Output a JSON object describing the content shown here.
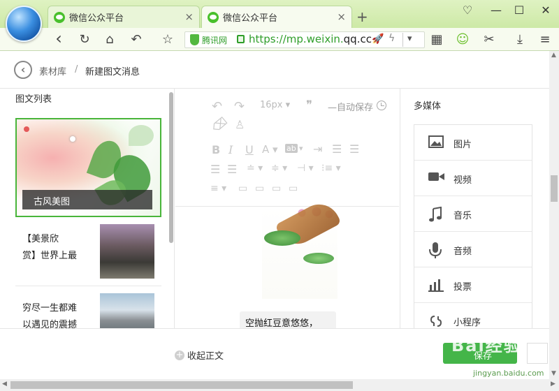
{
  "browser": {
    "tabs": [
      {
        "label": "微信公众平台",
        "close": "×"
      },
      {
        "label": "微信公众平台",
        "close": "×"
      }
    ],
    "new_tab": "+",
    "window_buttons": {
      "skin": "♡",
      "minimize": "—",
      "maximize": "☐",
      "close": "✕"
    },
    "nav": {
      "back": "‹",
      "refresh": "↻",
      "home": "⌂",
      "undo": "↶",
      "favorite": "☆"
    },
    "url": {
      "security_label": "腾讯网",
      "scheme": "https://mp.weixin.",
      "domain": "qq.cc",
      "dropdown": "▾"
    },
    "right_tools": {
      "apps": "▦",
      "ext": "☺",
      "cut": "✂",
      "download": "⤓",
      "menu": "≡"
    }
  },
  "breadcrumb": {
    "back": "‹",
    "home": "素材库",
    "separator": "/",
    "current": "新建图文消息"
  },
  "article_list": {
    "title": "图文列表",
    "items": [
      {
        "caption": "古风美图"
      },
      {
        "lines": [
          "【美景欣",
          "赏】世界上最"
        ]
      },
      {
        "lines": [
          "穷尽一生都难",
          "以遇见的震撼"
        ]
      }
    ]
  },
  "editor": {
    "font_size": "16px",
    "quote": "❞",
    "auto_save": "自动保存",
    "body_text": "空抛红豆意悠悠，",
    "toolbar": {
      "undo": "↶",
      "redo": "↷",
      "bold": "B",
      "italic": "I",
      "underline": "U",
      "font_color": "A",
      "bg_color": "ab",
      "eraser": "⌫",
      "format": "♙"
    }
  },
  "multimedia": {
    "title": "多媒体",
    "items": [
      {
        "label": "图片",
        "icon": "image-icon"
      },
      {
        "label": "视频",
        "icon": "video-icon"
      },
      {
        "label": "音乐",
        "icon": "music-icon"
      },
      {
        "label": "音频",
        "icon": "microphone-icon"
      },
      {
        "label": "投票",
        "icon": "vote-icon"
      },
      {
        "label": "小程序",
        "icon": "mini-program-icon"
      }
    ]
  },
  "footer": {
    "collapse_icon": "+",
    "collapse_label": "收起正文",
    "save_label": "保存",
    "watermark": "Bai经验",
    "watermark_url": "jingyan.baidu.com"
  },
  "colors": {
    "accent": "#44b549",
    "tab_bar": "#cde9a6",
    "link_green": "#2f9e2a"
  }
}
